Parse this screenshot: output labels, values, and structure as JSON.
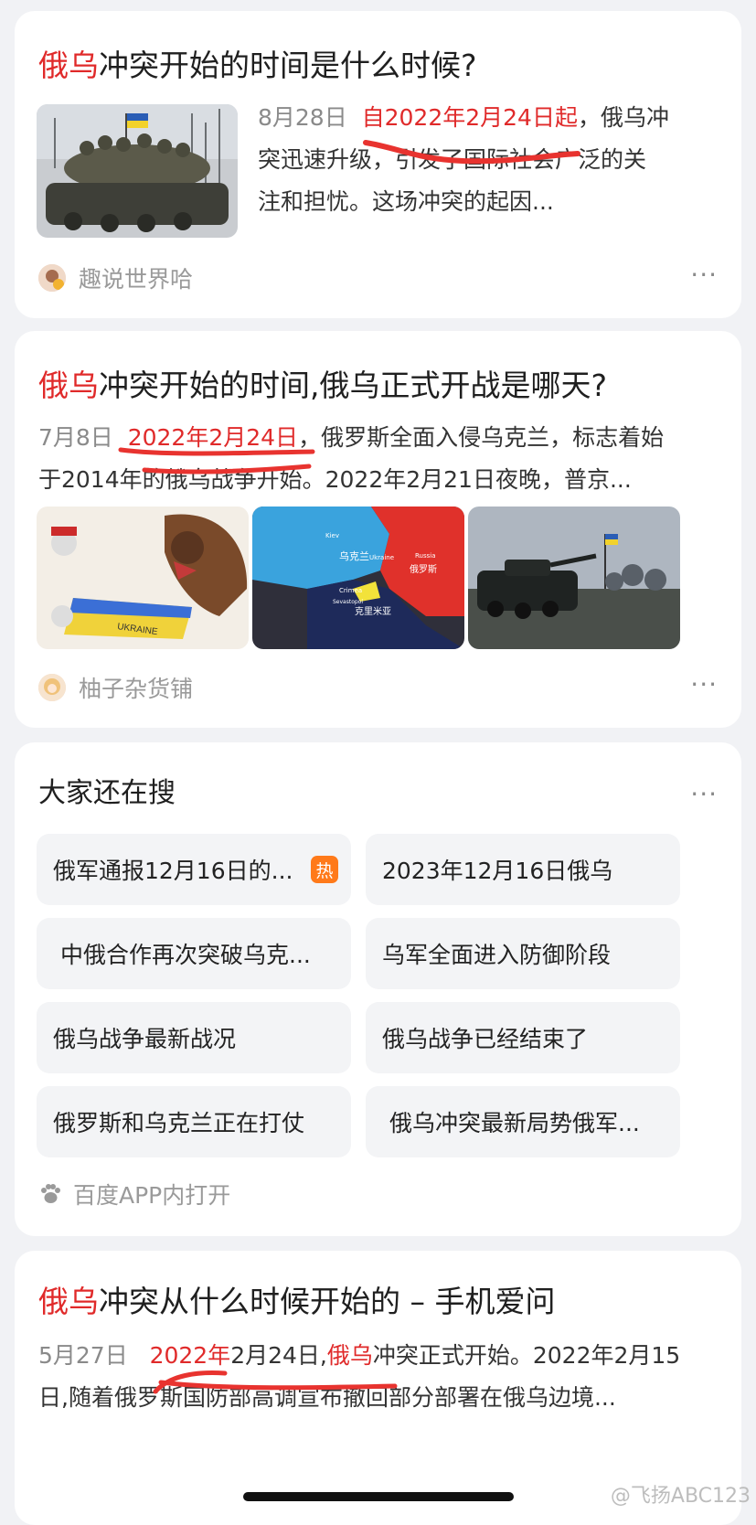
{
  "results": [
    {
      "title_red": "俄乌",
      "title_rest": "冲突开始的时间是什么时候?",
      "date": "8月28日",
      "snippet_highlight": "自2022年2月24日起",
      "snippet_line1_rest": "，俄乌冲",
      "snippet_line2": "突迅速升级，引发了国际社会广泛的关",
      "snippet_line3": "注和担忧。这场冲突的起因...",
      "source": "趣说世界哈",
      "more": "···"
    },
    {
      "title_red": "俄乌",
      "title_rest": "冲突开始的时间,俄乌正式开战是哪天?",
      "date": "7月8日",
      "snippet_highlight": "2022年2月24日",
      "snippet_line1_rest": "，俄罗斯全面入侵乌克兰，标志着始",
      "snippet_line2": "于2014年的俄乌战争开始。2022年2月21日夜晚，普京...",
      "image2_labels": [
        "乌克兰",
        "Ukraine",
        "Russia",
        "俄罗斯",
        "Kiev",
        "Crimea",
        "Sevastopol",
        "克里米亚"
      ],
      "image1_label": "UKRAINE",
      "source": "柚子杂货铺",
      "more": "···"
    },
    {
      "title_red": "俄乌",
      "title_rest": "冲突从什么时候开始的 – 手机爱问",
      "date": "5月27日",
      "snippet_hl1": "2022年",
      "snippet_mid": "2月24日,",
      "snippet_hl2": "俄乌",
      "snippet_line1_rest": "冲突正式开始。2022年2月15",
      "snippet_line2": "日,随着俄罗斯国防部高调宣布撤回部分部署在俄乌边境..."
    }
  ],
  "related": {
    "title": "大家还在搜",
    "more": "···",
    "items": [
      "俄军通报12月16日的...",
      "2023年12月16日俄乌",
      "中俄合作再次突破乌克...",
      "乌军全面进入防御阶段",
      "俄乌战争最新战况",
      "俄乌战争已经结束了",
      "俄罗斯和乌克兰正在打仗",
      "俄乌冲突最新局势俄军..."
    ],
    "hot_badge": "热",
    "open_app": "百度APP内打开"
  },
  "watermark": "@飞扬ABC123",
  "colors": {
    "accent_red": "#e02a2a",
    "hot_orange": "#ff7a1a",
    "background": "#f1f2f5"
  }
}
